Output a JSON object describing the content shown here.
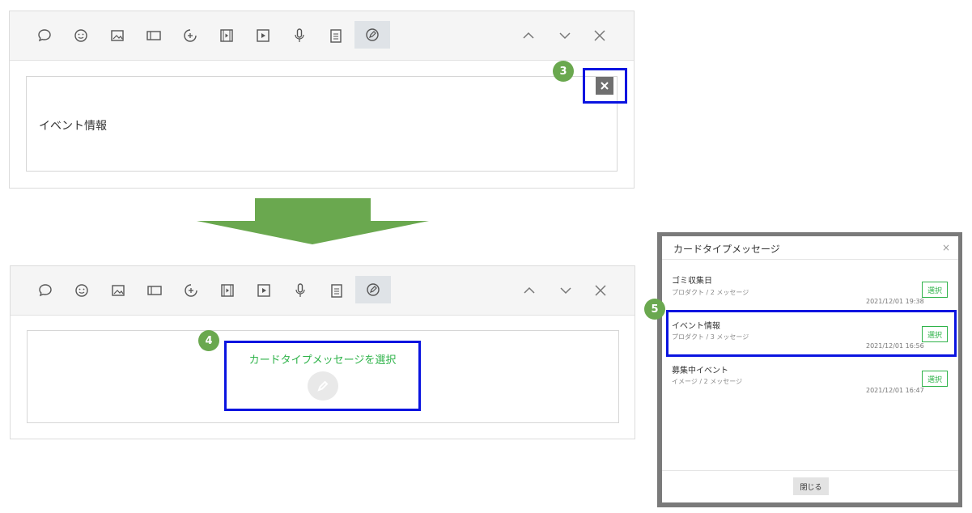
{
  "top_panel": {
    "content_text": "イベント情報",
    "delete_icon": "close-icon",
    "badge": "3"
  },
  "bottom_panel": {
    "select_text": "カードタイプメッセージを選択",
    "badge": "4"
  },
  "toolbar_icons": [
    "speech-bubble-icon",
    "smiley-icon",
    "image-icon",
    "card-icon",
    "sticker-icon",
    "video-icon",
    "play-icon",
    "microphone-icon",
    "clipboard-icon",
    "card-message-icon"
  ],
  "toolbar_right_icons": [
    "chevron-up-icon",
    "chevron-down-icon",
    "close-icon"
  ],
  "modal": {
    "title": "カードタイプメッセージ",
    "close": "×",
    "badge": "5",
    "items": [
      {
        "title": "ゴミ収集日",
        "sub": "プロダクト / 2 メッセージ",
        "date": "2021/12/01 19:38",
        "button": "選択"
      },
      {
        "title": "イベント情報",
        "sub": "プロダクト / 3 メッセージ",
        "date": "2021/12/01 16:56",
        "button": "選択"
      },
      {
        "title": "募集中イベント",
        "sub": "イメージ / 2 メッセージ",
        "date": "2021/12/01 16:47",
        "button": "選択"
      }
    ],
    "close_button": "閉じる"
  },
  "colors": {
    "highlight": "#0a14e0",
    "badge": "#6aa84f",
    "accent_green": "#2fb34a",
    "arrow": "#6aa84f"
  }
}
